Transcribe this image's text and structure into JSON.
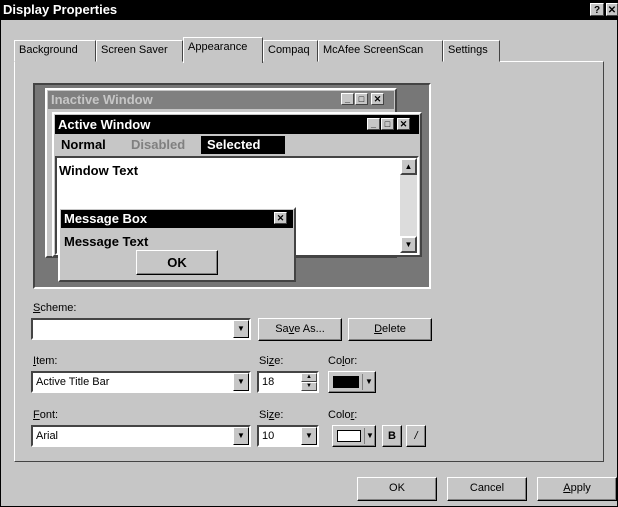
{
  "window": {
    "title": "Display Properties",
    "help_btn": "?",
    "close_btn": "✕"
  },
  "tabs": [
    {
      "label": "Background"
    },
    {
      "label": "Screen Saver"
    },
    {
      "label": "Appearance"
    },
    {
      "label": "Compaq"
    },
    {
      "label": "McAfee ScreenScan"
    },
    {
      "label": "Settings"
    }
  ],
  "preview": {
    "inactive_title": "Inactive Window",
    "active_title": "Active Window",
    "menu_normal": "Normal",
    "menu_disabled": "Disabled",
    "menu_selected": "Selected",
    "window_text": "Window Text",
    "msgbox_title": "Message Box",
    "msgbox_text": "Message Text",
    "msgbox_ok": "OK",
    "btn_min": "_",
    "btn_max": "□",
    "btn_close": "✕"
  },
  "scheme": {
    "label_first": "S",
    "label_rest": "cheme:",
    "value": "",
    "save_as_a": "Sa",
    "save_as_u": "v",
    "save_as_b": "e As...",
    "delete_u": "D",
    "delete_rest": "elete"
  },
  "item": {
    "label_first": "I",
    "label_rest": "tem:",
    "value": "Active Title Bar",
    "size_label_a": "Si",
    "size_label_u": "z",
    "size_label_b": "e:",
    "size_value": "18",
    "color_label_a": "Co",
    "color_label_u": "l",
    "color_label_b": "or:",
    "color": "#000000"
  },
  "font": {
    "label_first": "F",
    "label_rest": "ont:",
    "value": "Arial",
    "size_label_a": "Si",
    "size_label_u": "z",
    "size_label_b": "e:",
    "size_value": "10",
    "color_label_a": "Colo",
    "color_label_u": "r",
    "color_label_b": ":",
    "color": "#ffffff",
    "bold": "B",
    "italic": "/"
  },
  "buttons": {
    "ok": "OK",
    "cancel": "Cancel",
    "apply_u": "A",
    "apply_rest": "pply"
  }
}
